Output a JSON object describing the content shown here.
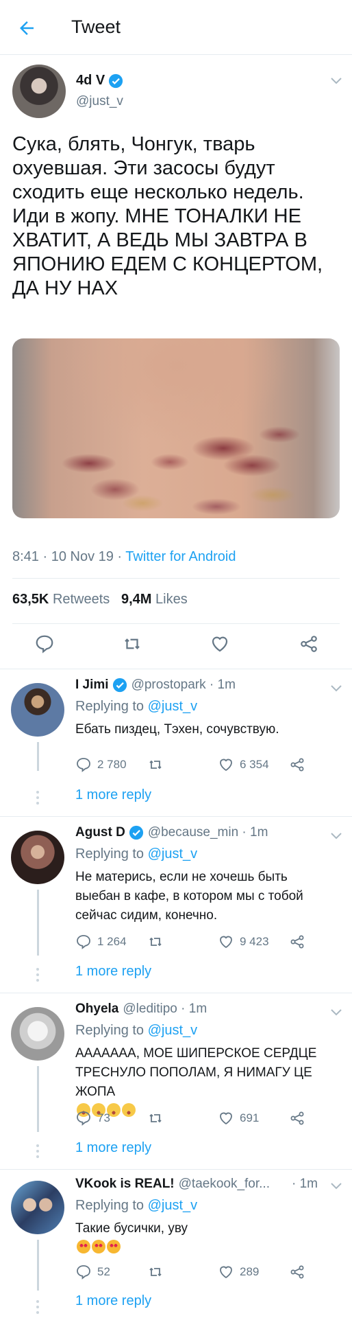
{
  "header": {
    "title": "Tweet"
  },
  "main_tweet": {
    "author": {
      "name": "4d V",
      "handle": "@just_v"
    },
    "text_lines": [
      "Сука, блять, Чонгук, тварь",
      "охуевшая. Эти засосы будут",
      "сходить еще несколько недель.",
      "Иди в жопу. МНЕ ТОНАЛКИ НЕ",
      "ХВАТИТ,  А ВЕДЬ МЫ ЗАВТРА В",
      "ЯПОНИЮ ЕДЕМ С КОНЦЕРТОМ,",
      "ДА НУ НАХ"
    ],
    "time": "8:41 · 10 Nov 19 · ",
    "source": "Twitter for Android",
    "retweets_count": "63,5K",
    "retweets_label": "Retweets",
    "likes_count": "9,4M",
    "likes_label": "Likes"
  },
  "replies": [
    {
      "name": "I Jimi",
      "verified": true,
      "meta": "@prostopark · 1m",
      "replying_prefix": "Replying to ",
      "replying_handle": "@just_v",
      "lines": [
        "Ебать пиздец, Тэхен, сочувствую."
      ],
      "reply_count": "2 780",
      "retweet_count": "",
      "like_count": "6 354",
      "more": "1 more reply"
    },
    {
      "name": "Agust D",
      "verified": true,
      "meta": "@because_min · 1m",
      "replying_prefix": "Replying to ",
      "replying_handle": "@just_v",
      "lines": [
        "Не матерись, если не хочешь быть",
        "выебан в кафе, в котором мы с тобой",
        "сейчас сидим, конечно."
      ],
      "reply_count": "1 264",
      "retweet_count": "",
      "like_count": "9 423",
      "more": "1 more reply"
    },
    {
      "name": "Ohyela",
      "verified": false,
      "meta": "@leditipo · 1m",
      "replying_prefix": "Replying to ",
      "replying_handle": "@just_v",
      "lines": [
        "ААААААА, МОЕ ШИПЕРСКОЕ СЕРДЦЕ",
        "ТРЕСНУЛО ПОПОЛАМ, Я НИМАГУ ЦЕ",
        "ЖОПА"
      ],
      "reply_count": "73",
      "retweet_count": "",
      "like_count": "691",
      "more": "1 more reply"
    },
    {
      "name": "VKook is REAL!",
      "verified": false,
      "meta": "@taekook_for...",
      "meta_time": "· 1m",
      "replying_prefix": "Replying to ",
      "replying_handle": "@just_v",
      "lines": [
        "Такие бусички, уву"
      ],
      "reply_count": "52",
      "retweet_count": "",
      "like_count": "289",
      "more": "1 more reply"
    }
  ],
  "colors": {
    "accent": "#1da1f2",
    "secondary_text": "#657786",
    "divider": "#e6ecf0"
  },
  "icons": [
    "back-arrow-icon",
    "verified-badge-icon",
    "chevron-down-icon",
    "reply-icon",
    "retweet-icon",
    "like-icon",
    "share-icon",
    "astonished-emoji-icon",
    "heart-eyes-cat-emoji-icon"
  ]
}
